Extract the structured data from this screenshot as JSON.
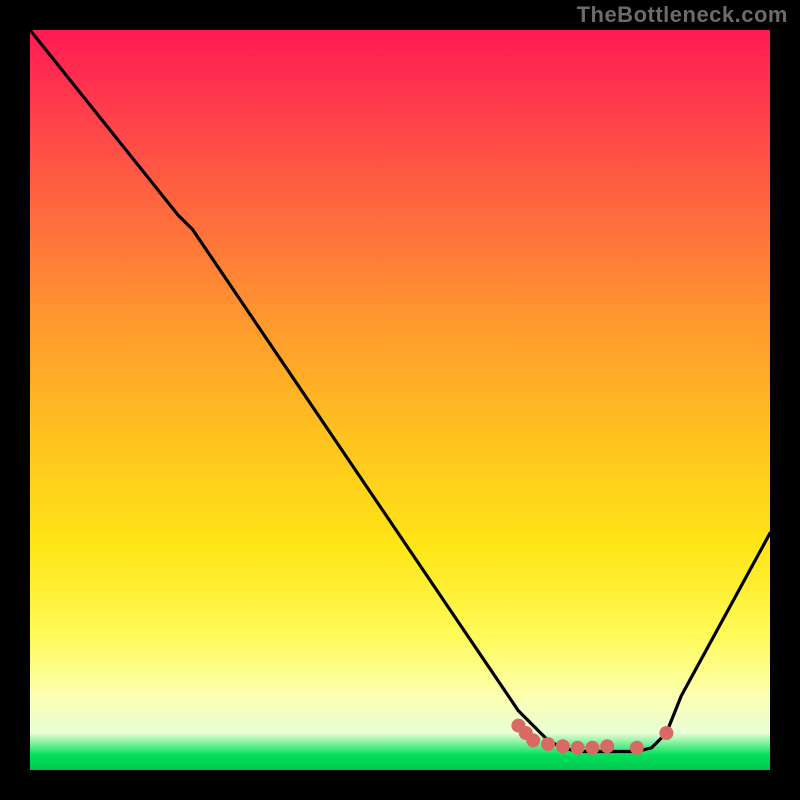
{
  "watermark": "TheBottleneck.com",
  "chart_data": {
    "type": "line",
    "title": "",
    "xlabel": "",
    "ylabel": "",
    "xlim": [
      0,
      100
    ],
    "ylim": [
      0,
      100
    ],
    "series": [
      {
        "name": "bottleneck-curve",
        "x": [
          0,
          20,
          22,
          66,
          70,
          72,
          74,
          76,
          78,
          80,
          82,
          84,
          86,
          88,
          100
        ],
        "values": [
          100,
          75,
          73,
          8,
          4,
          3,
          2.5,
          2.5,
          2.5,
          2.5,
          2.5,
          3,
          5,
          10,
          32
        ]
      }
    ],
    "markers": {
      "name": "highlight-dots",
      "color": "#d96a63",
      "points": [
        {
          "x": 66,
          "y": 6
        },
        {
          "x": 67,
          "y": 5
        },
        {
          "x": 68,
          "y": 4
        },
        {
          "x": 70,
          "y": 3.5
        },
        {
          "x": 72,
          "y": 3.2
        },
        {
          "x": 74,
          "y": 3
        },
        {
          "x": 76,
          "y": 3
        },
        {
          "x": 78,
          "y": 3.2
        },
        {
          "x": 82,
          "y": 3
        },
        {
          "x": 86,
          "y": 5
        }
      ]
    },
    "gradient_stops": [
      {
        "pct": 0,
        "color": "#ff1a53"
      },
      {
        "pct": 10,
        "color": "#ff3b4d"
      },
      {
        "pct": 25,
        "color": "#ff6b3d"
      },
      {
        "pct": 40,
        "color": "#ff9a2e"
      },
      {
        "pct": 55,
        "color": "#ffc21f"
      },
      {
        "pct": 70,
        "color": "#ffe617"
      },
      {
        "pct": 82,
        "color": "#fffb5a"
      },
      {
        "pct": 90,
        "color": "#fcffb0"
      },
      {
        "pct": 95,
        "color": "#e9ffd6"
      },
      {
        "pct": 98,
        "color": "#00e05a"
      },
      {
        "pct": 100,
        "color": "#00c84d"
      }
    ]
  }
}
